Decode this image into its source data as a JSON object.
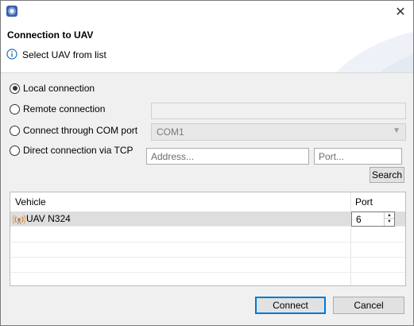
{
  "window": {
    "close_icon": "close-icon"
  },
  "header": {
    "title": "Connection to UAV",
    "message": "Select UAV from list"
  },
  "connection": {
    "options": [
      {
        "label": "Local connection",
        "checked": true
      },
      {
        "label": "Remote connection",
        "checked": false
      },
      {
        "label": "Connect through COM port",
        "checked": false
      },
      {
        "label": "Direct connection via TCP",
        "checked": false
      }
    ],
    "remote_value": "",
    "com_port_value": "COM1",
    "address_placeholder": "Address...",
    "port_placeholder": "Port...",
    "search_label": "Search"
  },
  "table": {
    "headers": {
      "vehicle": "Vehicle",
      "port": "Port"
    },
    "rows": [
      {
        "vehicle": "UAV N324",
        "port": "6",
        "selected": true
      }
    ]
  },
  "footer": {
    "connect_label": "Connect",
    "cancel_label": "Cancel"
  },
  "colors": {
    "accent": "#0078d7",
    "info": "#1e6fc4"
  }
}
